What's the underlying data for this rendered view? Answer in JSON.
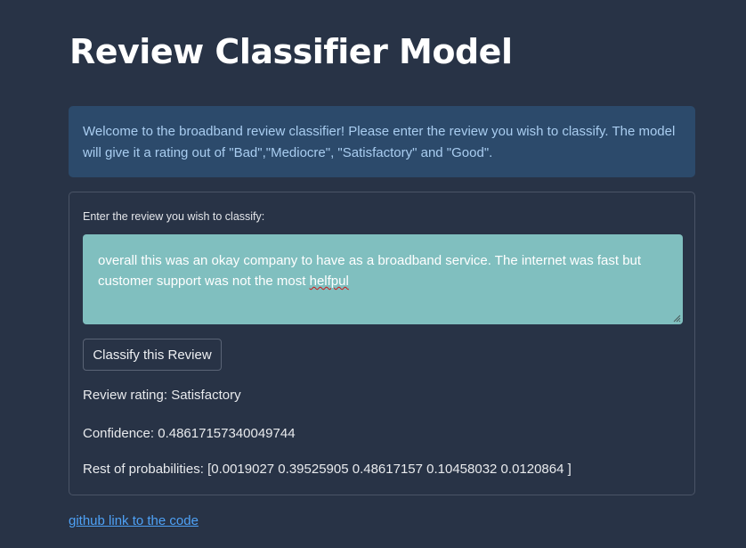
{
  "page": {
    "title": "Review Classifier Model"
  },
  "info": {
    "text": "Welcome to the broadband review classifier! Please enter the review you wish to classify. The model will give it a rating out of \"Bad\",\"Mediocre\", \"Satisfactory\" and \"Good\"."
  },
  "form": {
    "label": "Enter the review you wish to classify:",
    "review_text_before": "overall this was an okay company to have as a broadband service. The internet was fast but customer support was not the most ",
    "review_text_misspelled": "helfpul",
    "button_label": "Classify this Review"
  },
  "results": {
    "rating": "Review rating: Satisfactory",
    "confidence": "Confidence: 0.48617157340049744",
    "probabilities": "Rest of probabilities: [0.0019027 0.39525905 0.48617157 0.10458032 0.0120864 ]"
  },
  "footer": {
    "link_label": "github link to the code"
  },
  "colors": {
    "background": "#283346",
    "info_background": "#2c4a6b",
    "info_text": "#a9cdf0",
    "textarea_background": "#80bfbf",
    "link": "#4ea1f5"
  },
  "icons": {
    "resize": "resize-grip-icon"
  }
}
